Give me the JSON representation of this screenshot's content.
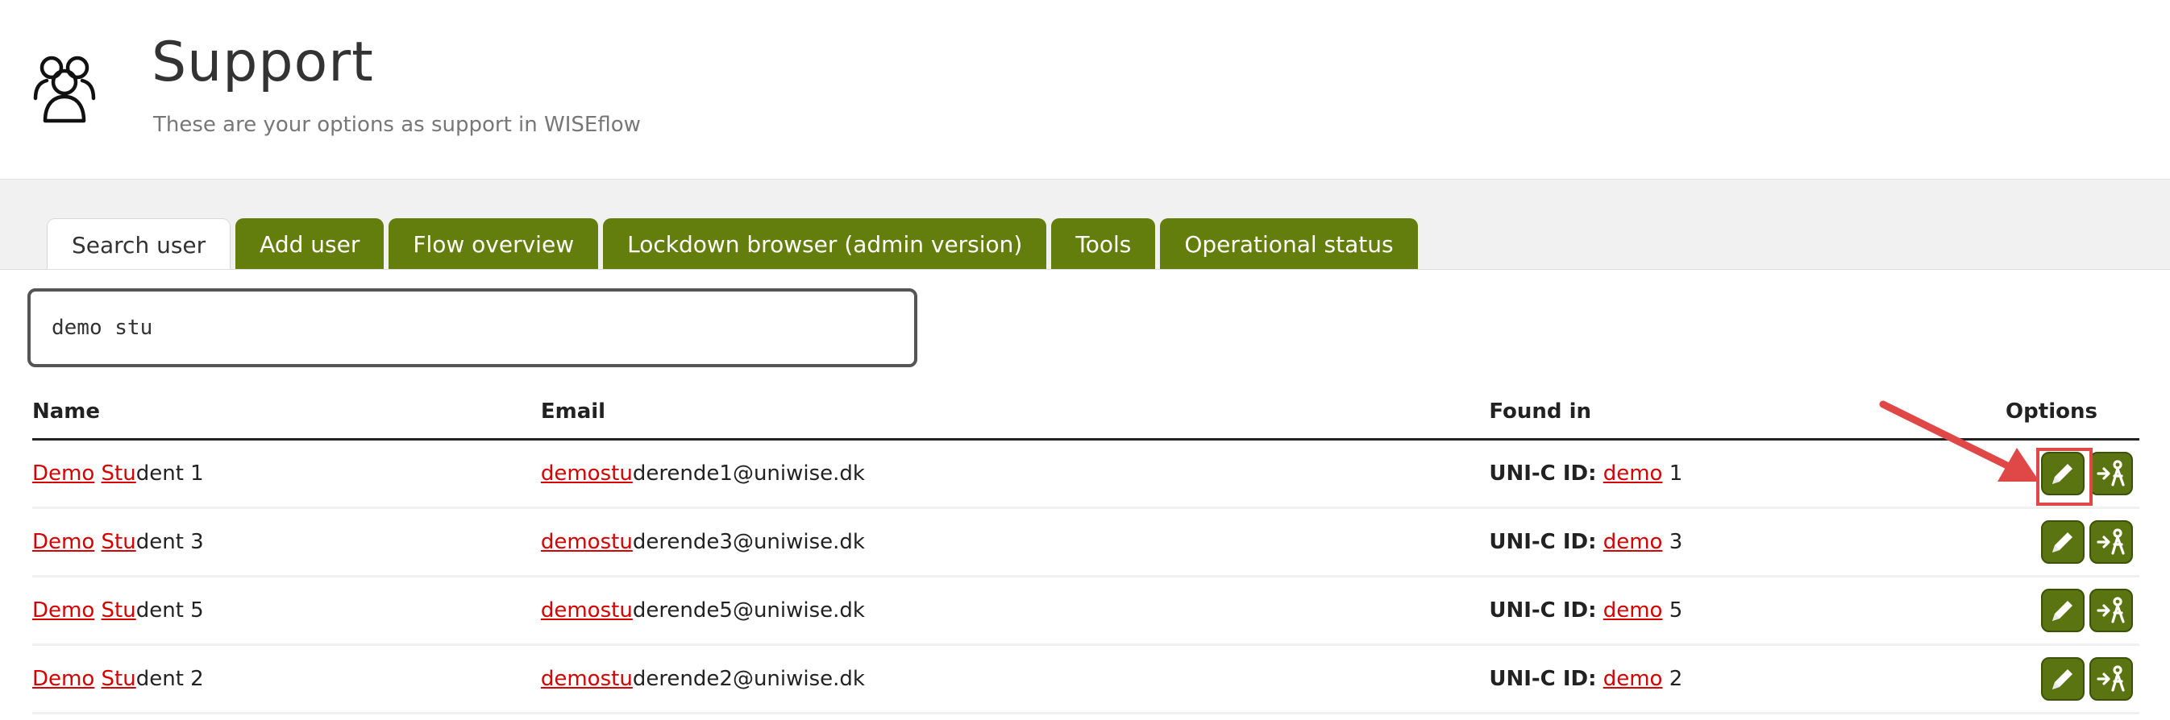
{
  "header": {
    "title": "Support",
    "subtitle": "These are your options as support in WISEflow",
    "icon": "users-icon"
  },
  "tabs": [
    {
      "label": "Search user",
      "active": true
    },
    {
      "label": "Add user",
      "active": false
    },
    {
      "label": "Flow overview",
      "active": false
    },
    {
      "label": "Lockdown browser (admin version)",
      "active": false
    },
    {
      "label": "Tools",
      "active": false
    },
    {
      "label": "Operational status",
      "active": false
    }
  ],
  "search": {
    "value": "demo stu"
  },
  "table": {
    "columns": [
      "Name",
      "Email",
      "Found in",
      "Options"
    ],
    "rows": [
      {
        "name": [
          "Demo",
          " ",
          "Stu",
          "dent 1"
        ],
        "email": [
          "demostu",
          "derende1@uniwise.dk"
        ],
        "found_label": "UNI-C ID:",
        "found": [
          "demo",
          " 1"
        ]
      },
      {
        "name": [
          "Demo",
          " ",
          "Stu",
          "dent 3"
        ],
        "email": [
          "demostu",
          "derende3@uniwise.dk"
        ],
        "found_label": "UNI-C ID:",
        "found": [
          "demo",
          " 3"
        ]
      },
      {
        "name": [
          "Demo",
          " ",
          "Stu",
          "dent 5"
        ],
        "email": [
          "demostu",
          "derende5@uniwise.dk"
        ],
        "found_label": "UNI-C ID:",
        "found": [
          "demo",
          " 5"
        ]
      },
      {
        "name": [
          "Demo",
          " ",
          "Stu",
          "dent 2"
        ],
        "email": [
          "demostu",
          "derende2@uniwise.dk"
        ],
        "found_label": "UNI-C ID:",
        "found": [
          "demo",
          " 2"
        ]
      }
    ],
    "options_icons": [
      "edit-pencil-icon",
      "impersonate-user-icon"
    ]
  },
  "colors": {
    "tab_green": "#637e0d",
    "button_green": "#5a7411",
    "highlight_red": "#d50000",
    "annotation_red": "#e04848"
  }
}
